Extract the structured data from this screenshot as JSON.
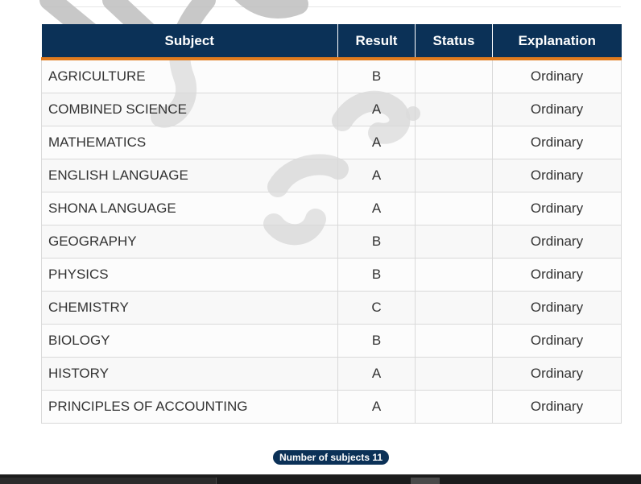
{
  "table": {
    "headers": {
      "subject": "Subject",
      "result": "Result",
      "status": "Status",
      "explanation": "Explanation"
    },
    "rows": [
      {
        "subject": "AGRICULTURE",
        "result": "B",
        "status": "",
        "explanation": "Ordinary"
      },
      {
        "subject": "COMBINED SCIENCE",
        "result": "A",
        "status": "",
        "explanation": "Ordinary"
      },
      {
        "subject": "MATHEMATICS",
        "result": "A",
        "status": "",
        "explanation": "Ordinary"
      },
      {
        "subject": "ENGLISH LANGUAGE",
        "result": "A",
        "status": "",
        "explanation": "Ordinary"
      },
      {
        "subject": "SHONA LANGUAGE",
        "result": "A",
        "status": "",
        "explanation": "Ordinary"
      },
      {
        "subject": "GEOGRAPHY",
        "result": "B",
        "status": "",
        "explanation": "Ordinary"
      },
      {
        "subject": "PHYSICS",
        "result": "B",
        "status": "",
        "explanation": "Ordinary"
      },
      {
        "subject": "CHEMISTRY",
        "result": "C",
        "status": "",
        "explanation": "Ordinary"
      },
      {
        "subject": "BIOLOGY",
        "result": "B",
        "status": "",
        "explanation": "Ordinary"
      },
      {
        "subject": "HISTORY",
        "result": "A",
        "status": "",
        "explanation": "Ordinary"
      },
      {
        "subject": "PRINCIPLES OF ACCOUNTING",
        "result": "A",
        "status": "",
        "explanation": "Ordinary"
      }
    ]
  },
  "summary": {
    "subject_count_label": "Number of subjects 11"
  },
  "colors": {
    "header_background": "#0b3157",
    "header_accent": "#e07b1e",
    "badge_background": "#0b3157",
    "watermark": "#bfbfbf"
  }
}
